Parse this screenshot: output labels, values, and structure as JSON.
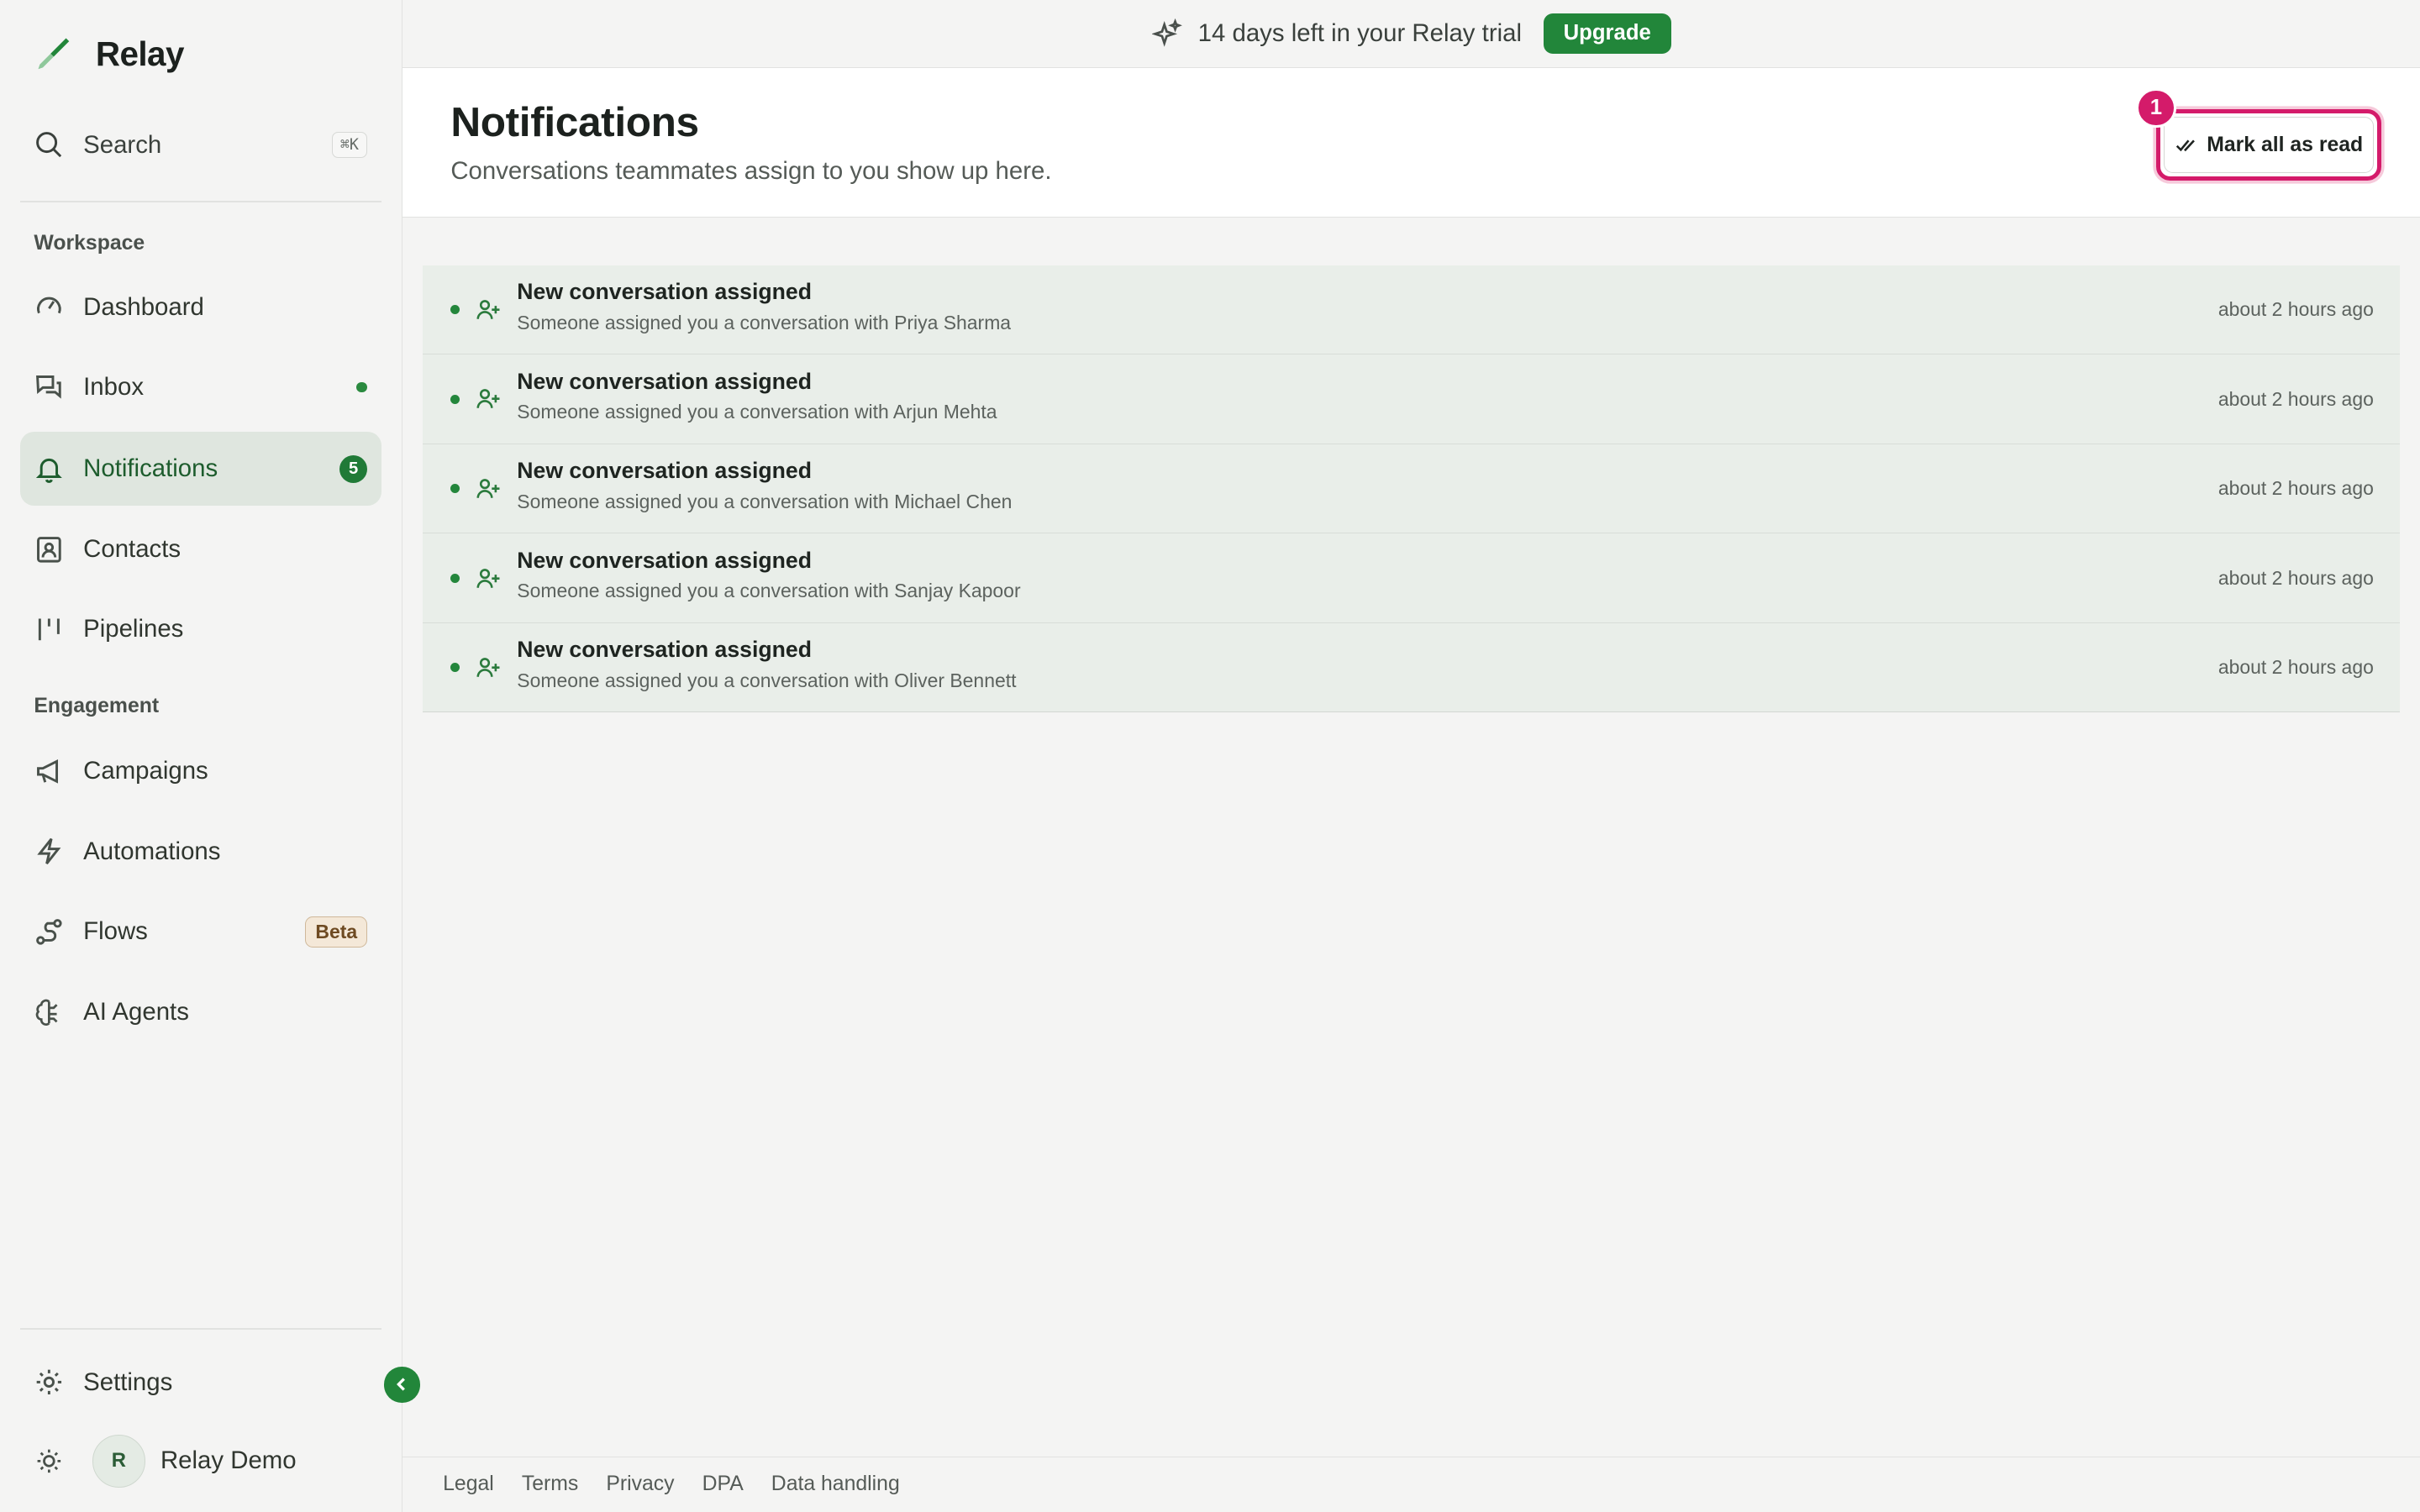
{
  "app": {
    "name": "Relay"
  },
  "sidebar": {
    "search_label": "Search",
    "search_shortcut": "⌘K",
    "sections": [
      {
        "label": "Workspace"
      },
      {
        "label": "Engagement"
      }
    ],
    "items": [
      {
        "label": "Dashboard",
        "icon": "gauge-icon"
      },
      {
        "label": "Inbox",
        "icon": "chat-bubbles-icon",
        "indicator": "unread-dot"
      },
      {
        "label": "Notifications",
        "icon": "bell-icon",
        "badge": "5",
        "active": true
      },
      {
        "label": "Contacts",
        "icon": "contact-card-icon"
      },
      {
        "label": "Pipelines",
        "icon": "pipeline-columns-icon"
      },
      {
        "label": "Campaigns",
        "icon": "megaphone-icon"
      },
      {
        "label": "Automations",
        "icon": "lightning-icon"
      },
      {
        "label": "Flows",
        "icon": "flow-nodes-icon",
        "badge": "Beta"
      },
      {
        "label": "AI Agents",
        "icon": "brain-icon"
      }
    ],
    "settings_label": "Settings",
    "user": {
      "initial": "R",
      "name": "Relay Demo"
    }
  },
  "banner": {
    "text": "14 days left in your Relay trial",
    "upgrade_label": "Upgrade"
  },
  "header": {
    "title": "Notifications",
    "subtitle": "Conversations teammates assign to you show up here.",
    "mark_all_label": "Mark all as read",
    "step_badge": "1"
  },
  "notifications": [
    {
      "title": "New conversation assigned",
      "description": "Someone assigned you a conversation with Priya Sharma",
      "time": "about 2 hours ago"
    },
    {
      "title": "New conversation assigned",
      "description": "Someone assigned you a conversation with Arjun Mehta",
      "time": "about 2 hours ago"
    },
    {
      "title": "New conversation assigned",
      "description": "Someone assigned you a conversation with Michael Chen",
      "time": "about 2 hours ago"
    },
    {
      "title": "New conversation assigned",
      "description": "Someone assigned you a conversation with Sanjay Kapoor",
      "time": "about 2 hours ago"
    },
    {
      "title": "New conversation assigned",
      "description": "Someone assigned you a conversation with Oliver Bennett",
      "time": "about 2 hours ago"
    }
  ],
  "footer": {
    "links": [
      "Legal",
      "Terms",
      "Privacy",
      "DPA",
      "Data handling"
    ]
  },
  "colors": {
    "accent": "#22863a",
    "highlight": "#d41b6a",
    "row_background": "#e9eee9"
  }
}
